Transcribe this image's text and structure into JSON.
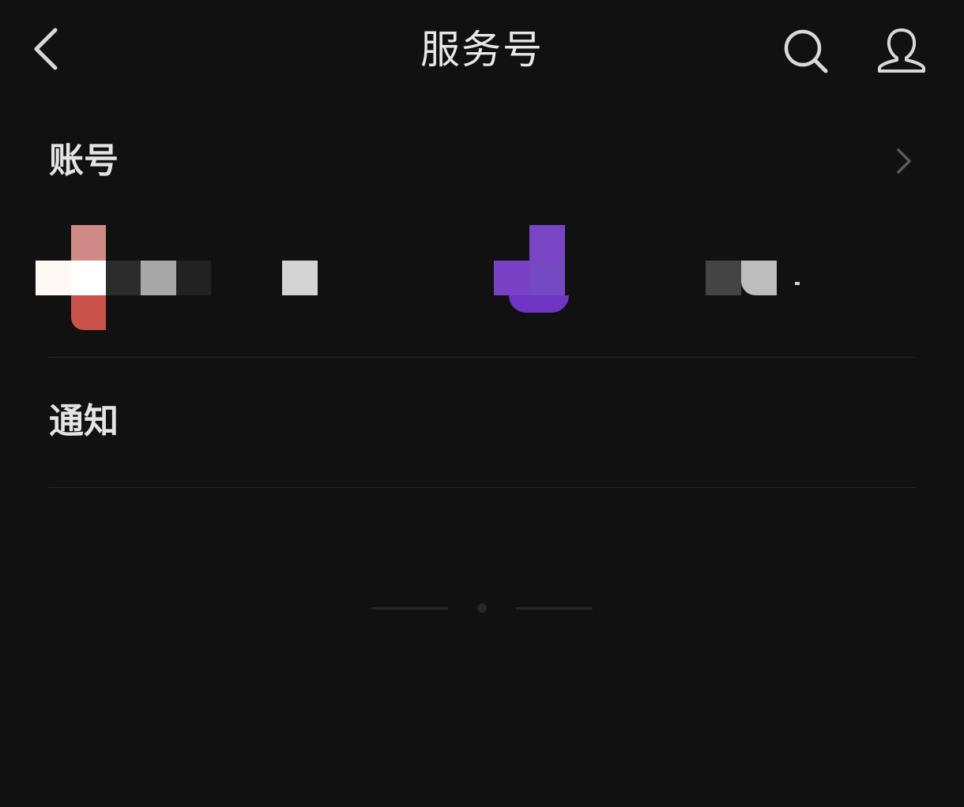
{
  "header": {
    "title": "服务号",
    "back_icon": "chevron-left-icon",
    "search_icon": "search-icon",
    "profile_icon": "person-icon"
  },
  "sections": {
    "accounts": {
      "title": "账号",
      "more_icon": "chevron-right-icon",
      "avatars_note_color_1": "#c9534a",
      "avatars_note_color_2": "#7a45c4"
    },
    "notifications": {
      "title": "通知"
    }
  },
  "colors": {
    "background": "#111111",
    "text": "#e6e6e6",
    "divider": "#262626",
    "accent_red": "#c9534a",
    "accent_purple": "#7a45c4"
  }
}
